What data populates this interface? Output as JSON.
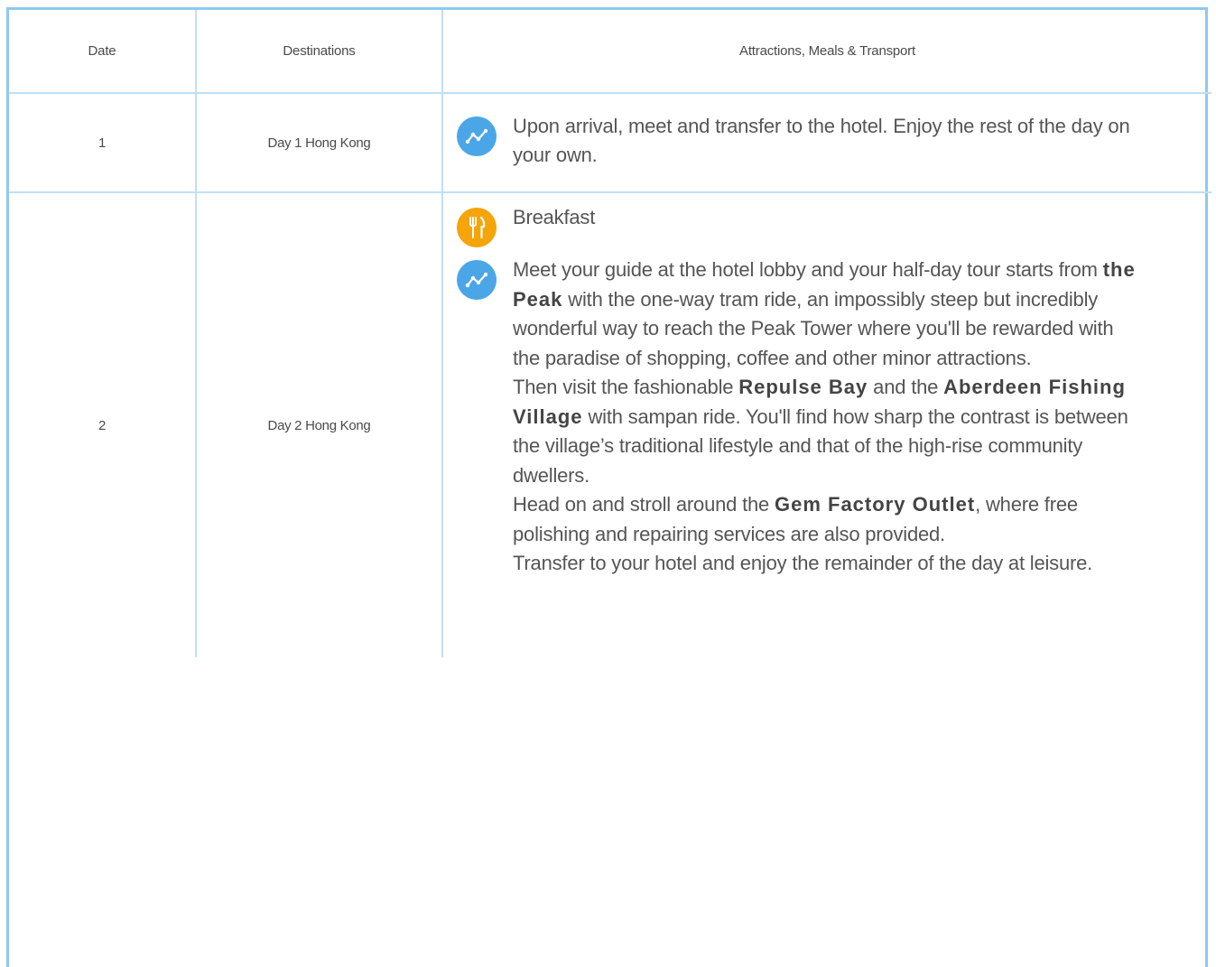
{
  "headers": {
    "date": "Date",
    "destinations": "Destinations",
    "activities": "Attractions, Meals & Transport"
  },
  "rows": [
    {
      "date": "1",
      "destination": "Day 1 Hong Kong",
      "activities": [
        {
          "icon": "route-icon",
          "text": "Upon arrival, meet and transfer to the hotel. Enjoy the rest of the day on your own."
        }
      ]
    },
    {
      "date": "2",
      "destination": "Day 2 Hong Kong",
      "activities": [
        {
          "icon": "meal-icon",
          "text": "Breakfast"
        },
        {
          "icon": "route-icon",
          "segments": {
            "s1": "Meet your guide at the hotel lobby and your half-day tour starts from ",
            "b1": "the Peak",
            "s2": " with the one-way tram ride, an impossibly steep but incredibly wonderful way to reach the Peak Tower where you'll be rewarded with the paradise of shopping, coffee and other minor attractions.",
            "s3": "Then visit the fashionable ",
            "b2": "Repulse Bay",
            "s4": " and the ",
            "b3": "Aberdeen Fishing Village",
            "s5": " with sampan ride. You'll find how sharp the contrast is between the village’s traditional lifestyle and that of the high-rise community dwellers.",
            "s6": "Head on and stroll around the ",
            "b4": "Gem Factory Outlet",
            "s7": ", where free polishing and repairing services are also provided.",
            "s8": "Transfer to your hotel and enjoy the remainder of the day at leisure."
          }
        }
      ]
    }
  ],
  "colors": {
    "border": "#8ec9ee",
    "grid": "#bfe0f5",
    "transport_icon": "#4aa6e6",
    "meal_icon": "#f5a40a"
  }
}
